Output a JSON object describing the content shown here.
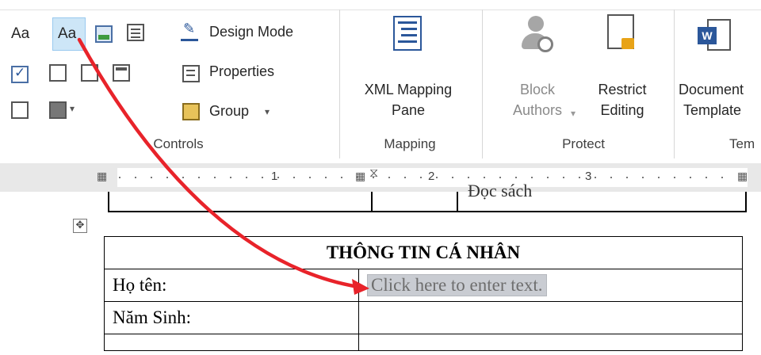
{
  "ribbon": {
    "controls": {
      "design_mode": "Design Mode",
      "properties": "Properties",
      "group": "Group",
      "group_label": "Controls",
      "rich_text_icon": "Aa",
      "plain_text_icon": "Aa"
    },
    "mapping": {
      "xml_mapping_line1": "XML Mapping",
      "xml_mapping_line2": "Pane",
      "group_label": "Mapping"
    },
    "protect": {
      "block_line1": "Block",
      "block_line2": "Authors",
      "restrict_line1": "Restrict",
      "restrict_line2": "Editing",
      "group_label": "Protect"
    },
    "templates": {
      "doc_line1": "Document",
      "doc_line2": "Template",
      "group_label": "Tem"
    }
  },
  "ruler": {
    "numbers": [
      "1",
      "2",
      "3"
    ]
  },
  "document": {
    "prev_table_text": "Đọc sách",
    "table_title": "THÔNG TIN CÁ NHÂN",
    "row1_label": "Họ tên:",
    "row1_placeholder": "Click here to enter text.",
    "row2_label": "Năm Sinh:"
  },
  "colors": {
    "arrow": "#e8232a",
    "word_blue": "#2b579a",
    "lock_gold": "#e8a317",
    "selected_bg": "#cde6f7"
  }
}
